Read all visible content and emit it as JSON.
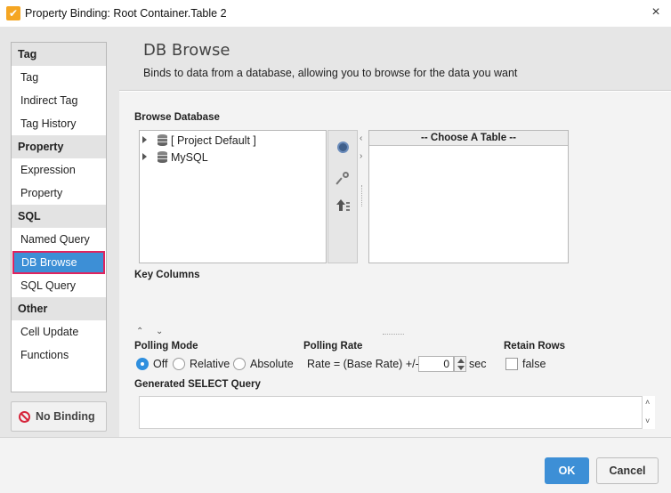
{
  "window": {
    "title": "Property Binding: Root Container.Table 2",
    "close_label": "×",
    "app_icon_glyph": "✔"
  },
  "sidebar": {
    "sections": [
      {
        "header": "Tag",
        "items": [
          "Tag",
          "Indirect Tag",
          "Tag History"
        ]
      },
      {
        "header": "Property",
        "items": [
          "Expression",
          "Property"
        ]
      },
      {
        "header": "SQL",
        "items": [
          "Named Query",
          "DB Browse",
          "SQL Query"
        ]
      },
      {
        "header": "Other",
        "items": [
          "Cell Update",
          "Functions"
        ]
      }
    ],
    "selected_item": "DB Browse",
    "no_binding_label": "No Binding"
  },
  "header": {
    "title": "DB Browse",
    "description": "Binds to data from a database, allowing you to browse for the data you want"
  },
  "browse": {
    "label": "Browse Database",
    "databases": [
      "[ Project Default ]",
      "MySQL"
    ],
    "table_header": "-- Choose A Table --",
    "split_left": "‹",
    "split_right": "›"
  },
  "key_columns": {
    "label": "Key Columns"
  },
  "collapse": {
    "up": "⌃",
    "down": "⌄"
  },
  "polling": {
    "mode_label": "Polling Mode",
    "options": [
      "Off",
      "Relative",
      "Absolute"
    ],
    "selected": "Off",
    "rate_label": "Polling Rate",
    "rate_prefix": "Rate = (Base Rate) +/-",
    "rate_value": "0",
    "rate_unit": "sec"
  },
  "retain": {
    "label": "Retain Rows",
    "value_label": "false",
    "checked": false
  },
  "query": {
    "label": "Generated SELECT Query",
    "value": "",
    "scroll_up": "˄",
    "scroll_down": "˅"
  },
  "footer": {
    "ok_label": "OK",
    "cancel_label": "Cancel"
  },
  "colors": {
    "accent": "#3d8fd6",
    "selection_outline": "#e0245e",
    "no_binding_icon": "#d6243a",
    "app_icon": "#f5a623"
  },
  "icons": [
    "app-icon",
    "close-icon",
    "no-binding-icon",
    "database-icon",
    "refresh-icon",
    "key-icon",
    "sort-icon",
    "expand-arrow-icon"
  ]
}
